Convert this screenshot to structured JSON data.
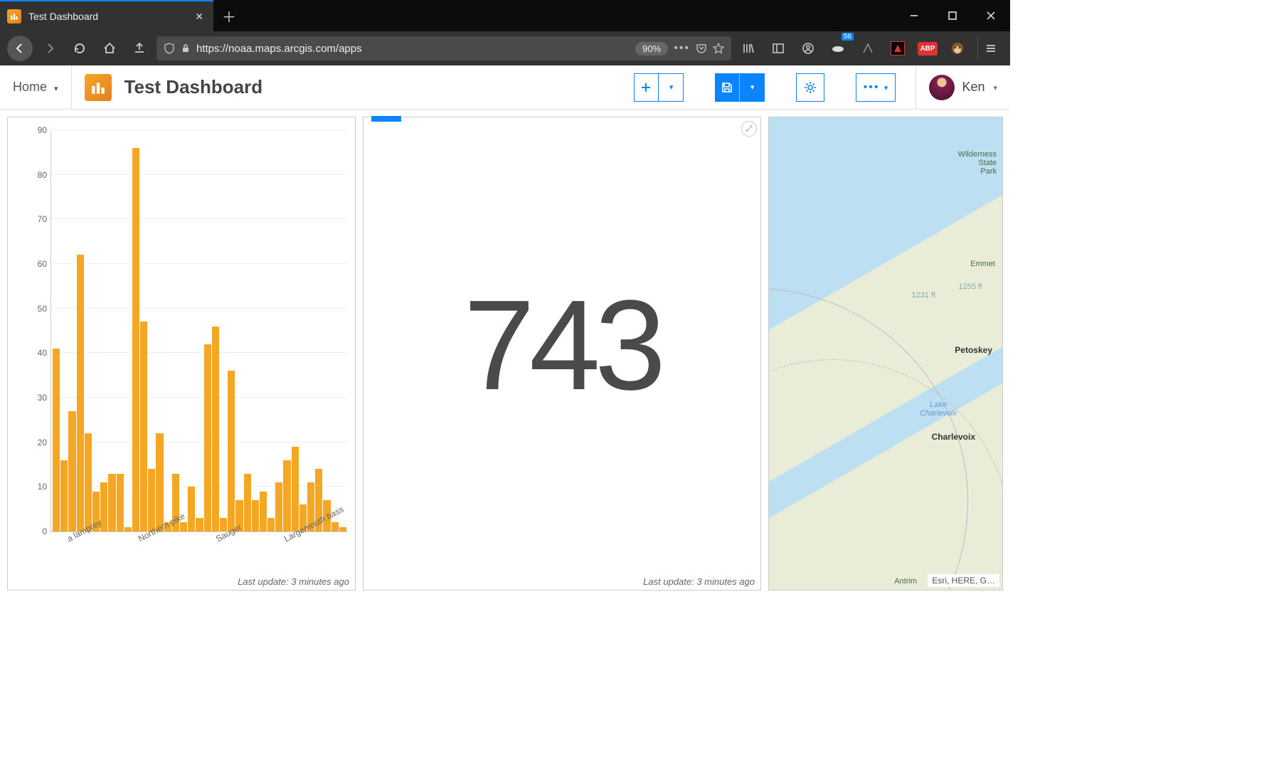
{
  "browser": {
    "tab_title": "Test Dashboard",
    "url": "https://noaa.maps.arcgis.com/apps",
    "zoom": "90%",
    "notification_count": "56",
    "abp_label": "ABP"
  },
  "header": {
    "home_label": "Home",
    "title": "Test Dashboard",
    "user_name": "Ken"
  },
  "indicator": {
    "value": "743",
    "footer": "Last update: 3 minutes ago"
  },
  "chart_panel": {
    "footer": "Last update: 3 minutes ago"
  },
  "chart_data": {
    "type": "bar",
    "ylim": [
      0,
      90
    ],
    "yticks": [
      0,
      10,
      20,
      30,
      40,
      50,
      60,
      70,
      80,
      90
    ],
    "xticks": [
      {
        "label": "a lamprey",
        "pos": 0.05
      },
      {
        "label": "Northern pike",
        "pos": 0.29
      },
      {
        "label": "Sauger",
        "pos": 0.55
      },
      {
        "label": "Largemouth bass",
        "pos": 0.78
      }
    ],
    "values": [
      41,
      16,
      27,
      62,
      22,
      9,
      11,
      13,
      13,
      1,
      86,
      47,
      14,
      22,
      2,
      13,
      2,
      10,
      3,
      42,
      46,
      3,
      36,
      7,
      13,
      7,
      9,
      3,
      11,
      16,
      19,
      6,
      11,
      14,
      7,
      2,
      1
    ]
  },
  "map": {
    "attribution": "Esri, HERE, G…",
    "labels": {
      "wilderness": "Wilderness\nState\nPark",
      "emmet": "Emmet",
      "ft1": "1255 ft",
      "ft2": "1231 ft",
      "petoskey": "Petoskey",
      "lake": "Lake\nCharlevoix",
      "charlevoix": "Charlevoix",
      "antrim": "Antrim"
    }
  }
}
